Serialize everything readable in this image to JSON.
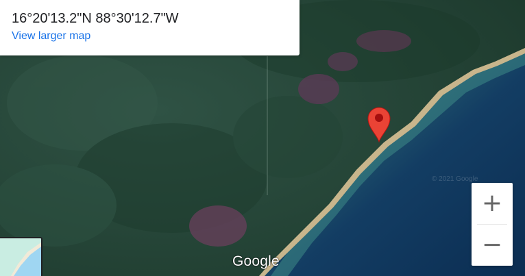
{
  "info_card": {
    "coordinates": "16°20'13.2\"N 88°30'12.7\"W",
    "larger_map_link": "View larger map"
  },
  "zoom": {
    "in_label": "+",
    "out_label": "−"
  },
  "logo": "Google",
  "watermark": "© 2021 Google",
  "marker": {
    "color": "#ea4335",
    "icon": "map-pin-icon"
  },
  "map": {
    "map_type": "satellite",
    "colors": {
      "forest": "#28473a",
      "forest_dark": "#1d3a2c",
      "clearing": "#6a3f5c",
      "beach": "#c8b58c",
      "shallow_water": "#2c6a73",
      "deep_water": "#0b2d52"
    }
  },
  "layer_toggle": {
    "icon": "map-layer-thumbnail"
  }
}
